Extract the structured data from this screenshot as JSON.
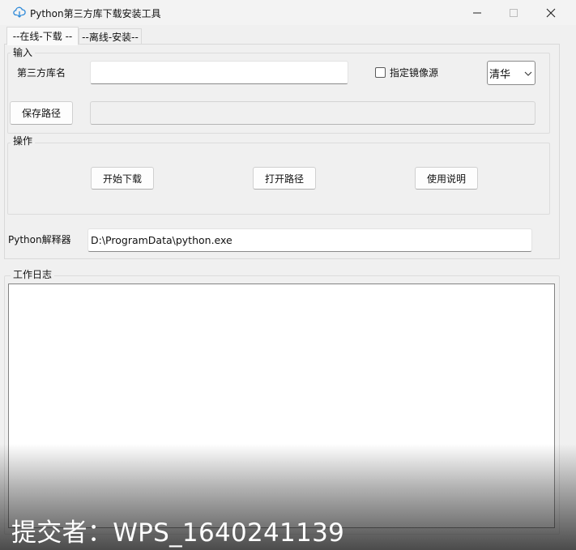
{
  "window": {
    "title": "Python第三方库下载安装工具",
    "app_icon": "cloud-download-icon",
    "controls": [
      "minimize-icon",
      "maximize-icon",
      "close-icon"
    ]
  },
  "tabs": [
    {
      "label": "--在线-下载 --",
      "active": true
    },
    {
      "label": "--离线-安装--",
      "active": false
    }
  ],
  "input_group": {
    "legend": "输入",
    "package_label": "第三方库名",
    "package_value": "",
    "mirror_checkbox_label": "指定镜像源",
    "mirror_checked": false,
    "mirror_selected": "清华",
    "save_path_button": "保存路径",
    "save_path_value": ""
  },
  "ops_group": {
    "legend": "操作",
    "start_download": "开始下载",
    "open_path": "打开路径",
    "usage": "使用说明"
  },
  "interpreter": {
    "label": "Python解释器",
    "value": "D:\\ProgramData\\python.exe"
  },
  "log_group": {
    "legend": "工作日志",
    "content": ""
  },
  "watermark": "提交者：WPS_1640241139",
  "colors": {
    "accent": "#2b88d8",
    "background": "#f0f0f0",
    "field": "#ffffff"
  }
}
